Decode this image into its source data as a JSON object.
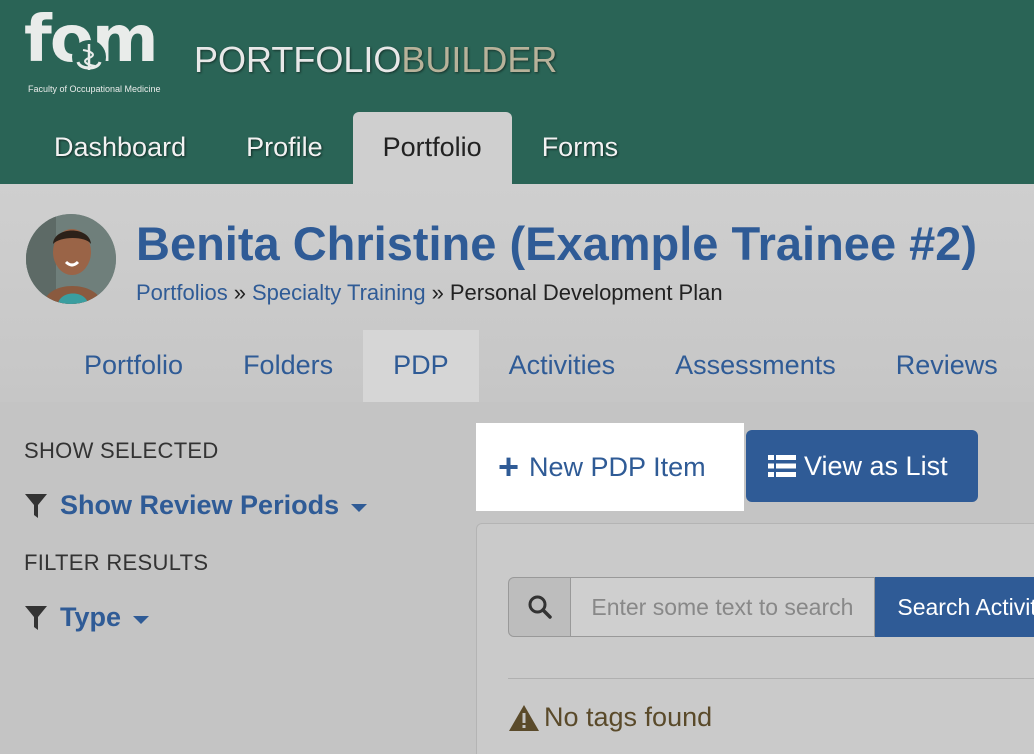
{
  "header": {
    "logo_letters": "fom",
    "logo_subtitle": "Faculty of Occupational Medicine",
    "brand_part1": "PORTFOLIO",
    "brand_part2": "BUILDER"
  },
  "main_nav": {
    "tabs": [
      {
        "label": "Dashboard"
      },
      {
        "label": "Profile"
      },
      {
        "label": "Portfolio"
      },
      {
        "label": "Forms"
      }
    ],
    "active": "Portfolio"
  },
  "profile": {
    "name": "Benita Christine (Example Trainee #2)",
    "breadcrumb": {
      "items": [
        "Portfolios",
        "Specialty Training"
      ],
      "separator": "»",
      "current": "Personal Development Plan"
    }
  },
  "sub_nav": {
    "tabs": [
      {
        "label": "Portfolio"
      },
      {
        "label": "Folders"
      },
      {
        "label": "PDP"
      },
      {
        "label": "Activities"
      },
      {
        "label": "Assessments"
      },
      {
        "label": "Reviews"
      }
    ],
    "active": "PDP"
  },
  "sidebar": {
    "show_selected_heading": "SHOW SELECTED",
    "review_periods_filter": "Show Review Periods",
    "filter_results_heading": "FILTER RESULTS",
    "type_filter": "Type"
  },
  "actions": {
    "new_item_label": "New PDP Item",
    "view_list_label": "View as List"
  },
  "search": {
    "placeholder": "Enter some text to search",
    "button_label": "Search Activities"
  },
  "empty_state": {
    "no_tags_text": "No tags found"
  },
  "colors": {
    "header_bg": "#2a6456",
    "link_blue": "#2f5b96",
    "brand_accent": "#b7b29a",
    "page_bg": "#c4c4c4"
  }
}
